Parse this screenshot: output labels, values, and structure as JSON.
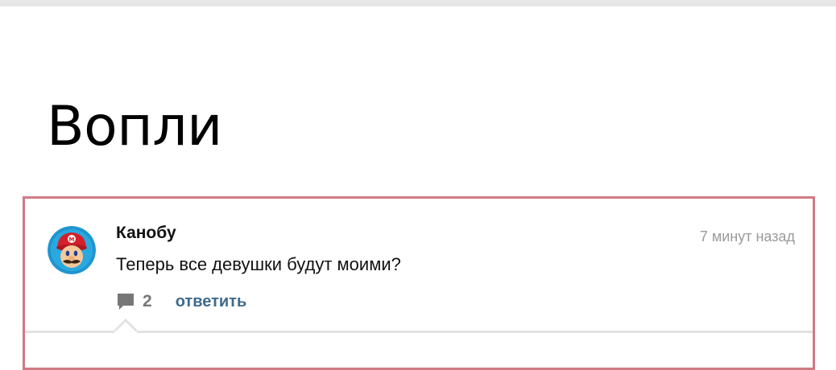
{
  "page": {
    "title": "Вопли"
  },
  "comment": {
    "author": "Канобу",
    "timestamp": "7 минут назад",
    "text": "Теперь все девушки будут моими?",
    "reply_count": "2",
    "reply_label": "ответить",
    "avatar_icon": "mario-avatar-icon",
    "comment_icon": "speech-bubble-icon"
  },
  "colors": {
    "card_border": "#d27a84",
    "reply_link": "#3f6a8c",
    "timestamp": "#9a9a9a",
    "top_strip": "#e6e6e6"
  }
}
